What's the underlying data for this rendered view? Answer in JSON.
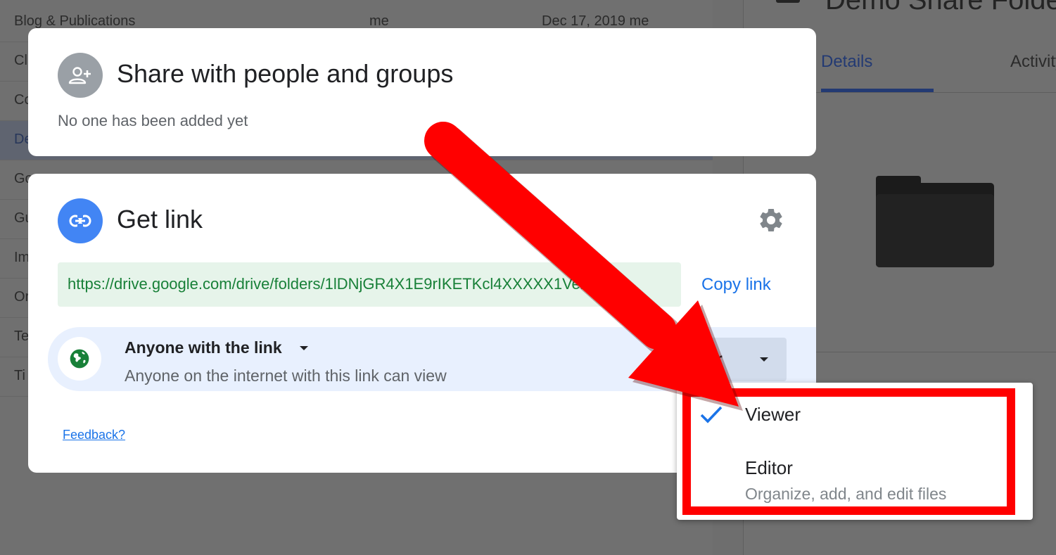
{
  "background": {
    "rows": [
      {
        "name": "Blog & Publications",
        "owner": "me",
        "modified": "Dec 17, 2019 me"
      },
      {
        "name": "Cl",
        "owner": "",
        "modified": ""
      },
      {
        "name": "Co",
        "owner": "",
        "modified": ""
      },
      {
        "name": "De",
        "owner": "",
        "modified": ""
      },
      {
        "name": "Go",
        "owner": "",
        "modified": ""
      },
      {
        "name": "Gu",
        "owner": "",
        "modified": ""
      },
      {
        "name": "Im",
        "owner": "",
        "modified": ""
      },
      {
        "name": "Or",
        "owner": "",
        "modified": ""
      },
      {
        "name": "Te",
        "owner": "",
        "modified": ""
      },
      {
        "name": "Ti",
        "owner": "",
        "modified": ""
      }
    ],
    "panel": {
      "title": "Demo Share Folder",
      "tabs": [
        {
          "label": "Details",
          "active": true
        },
        {
          "label": "Activity",
          "active": false
        }
      ]
    }
  },
  "share_card": {
    "title": "Share with people and groups",
    "subtitle": "No one has been added yet",
    "icon": "person-add-icon"
  },
  "link_card": {
    "title": "Get link",
    "icon": "link-icon",
    "settings_icon": "gear-icon",
    "url": "https://drive.google.com/drive/folders/1lDNjGR4X1E9rIKETKcl4XXXXX1Ver...",
    "copy_label": "Copy link",
    "access": {
      "title": "Anyone with the link",
      "description": "Anyone on the internet with this link can view",
      "icon": "globe-icon",
      "role_label": "Viewer"
    },
    "feedback_label": "Feedback?"
  },
  "role_menu": {
    "items": [
      {
        "label": "Viewer",
        "selected": true,
        "description": ""
      },
      {
        "label": "Editor",
        "selected": false,
        "description": "Organize, add, and edit files"
      }
    ]
  },
  "colors": {
    "accent": "#1a73e8",
    "annotation": "#ff0000",
    "url_bg": "#e6f4ea",
    "url_text": "#188038",
    "access_bg": "#e8f0fe"
  }
}
